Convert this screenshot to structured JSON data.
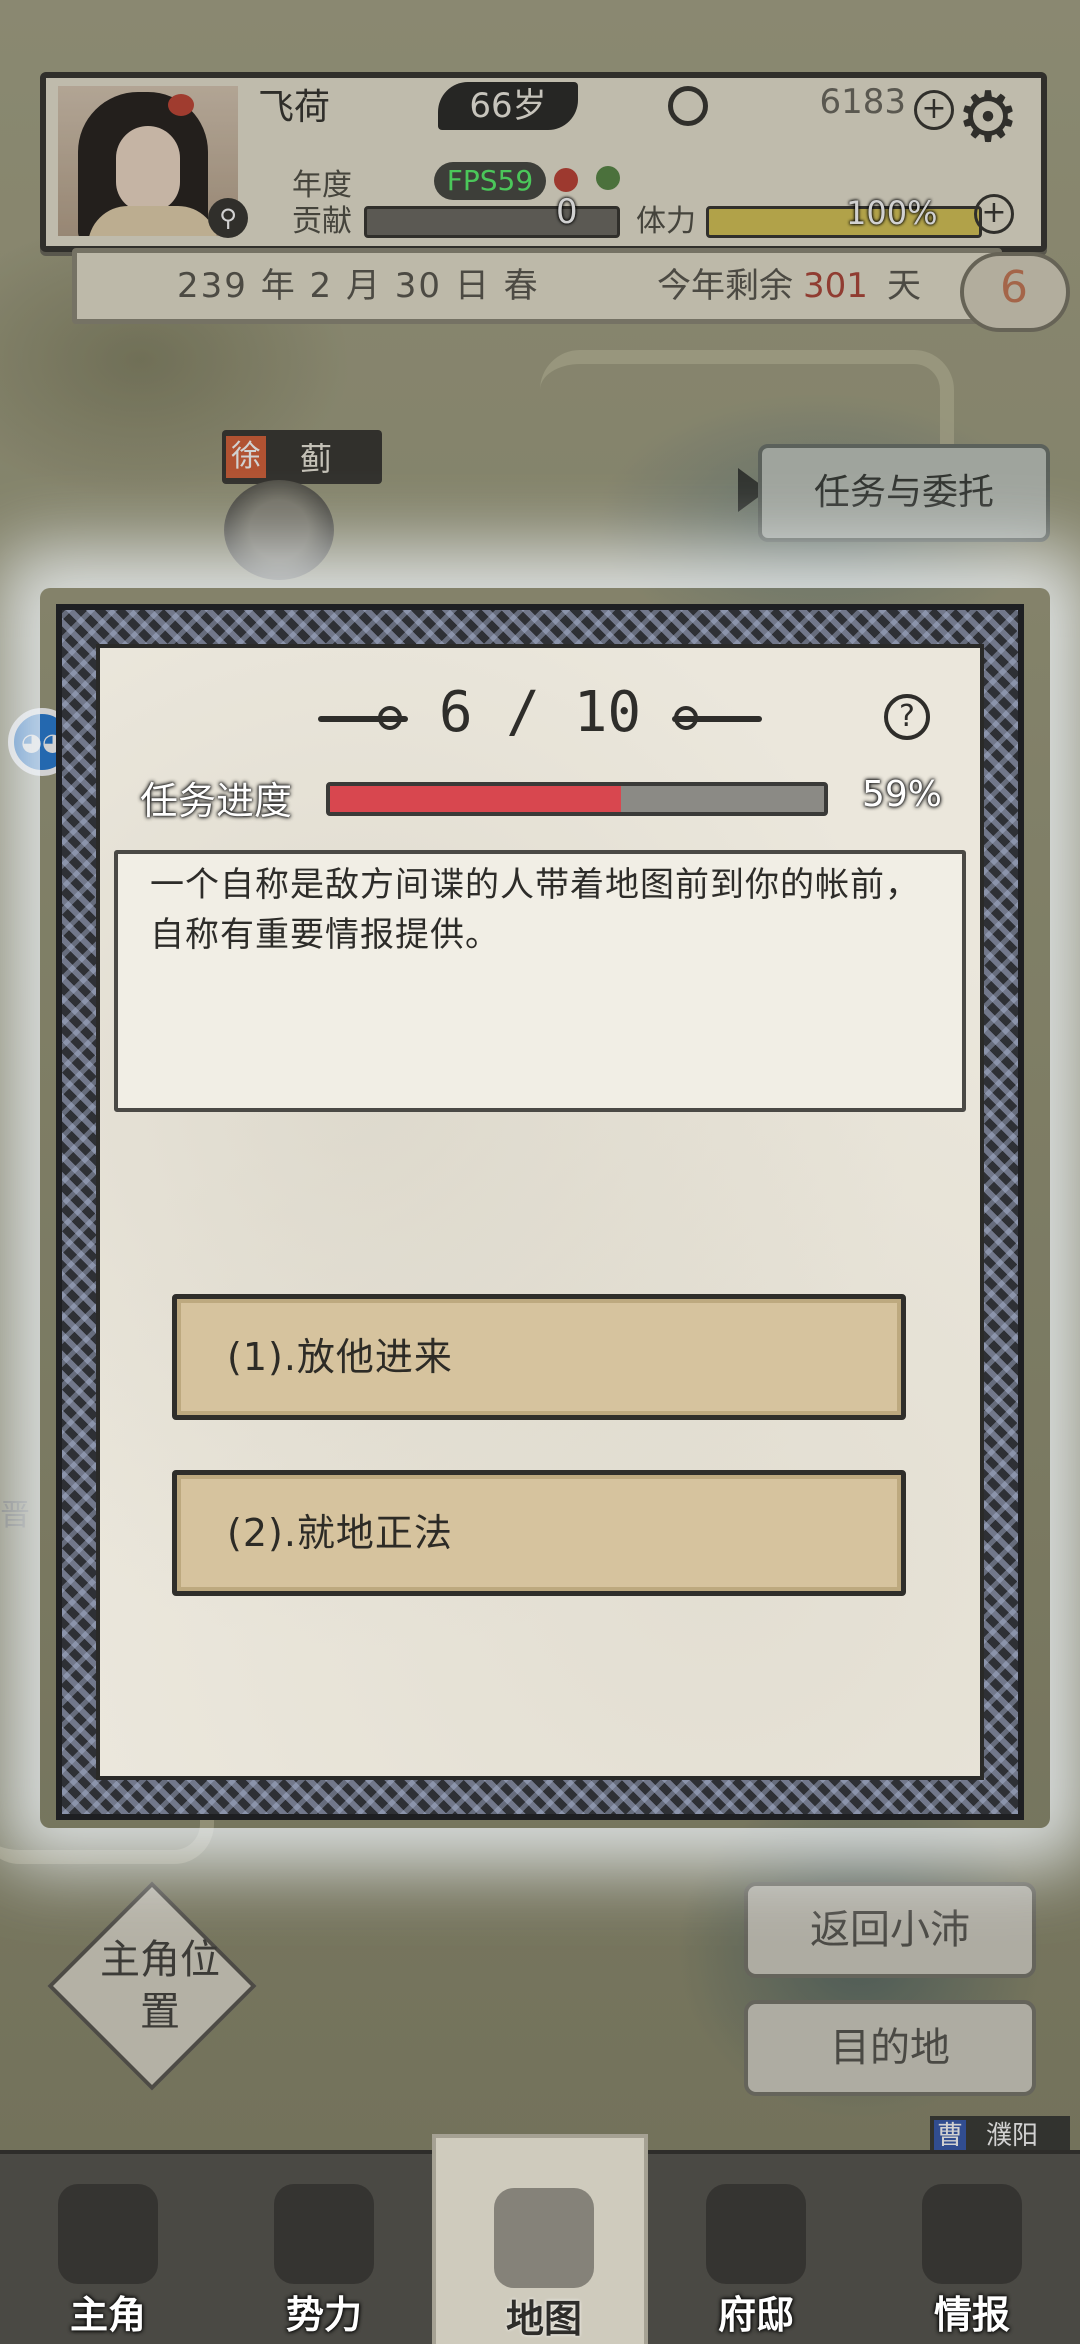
{
  "header": {
    "name": "飞荷",
    "age": "66岁",
    "coins": "6183",
    "fps": "FPS59",
    "year_label": "年度",
    "contrib_label": "贡献",
    "contrib_value": "0",
    "stamina_label": "体力",
    "stamina_value": "100%",
    "stamina_fraction": 1.0
  },
  "datebar": {
    "date": "239 年 2 月 30 日 春",
    "remain_label": "今年剩余",
    "remain_days": "301",
    "remain_unit": "天",
    "badge": "6"
  },
  "map": {
    "city_tag_faction": "徐",
    "city_tag_name": "蓟",
    "side_label": "晋",
    "quest_button": "任务与委托",
    "return_button": "返回小沛",
    "destination_button": "目的地",
    "player_position": "主角位置",
    "corner_tag_faction": "曹",
    "corner_tag_name": "濮阳"
  },
  "dialog": {
    "step": "6 / 10",
    "progress_label": "任务进度",
    "progress_percent": "59%",
    "progress_fraction": 0.59,
    "description": "一个自称是敌方间谍的人带着地图前到你的帐前，自称有重要情报提供。",
    "choices": [
      "(1).放他进来",
      "(2).就地正法"
    ]
  },
  "nav": [
    "主角",
    "势力",
    "地图",
    "府邸",
    "情报"
  ],
  "colors": {
    "progress_fill": "#d8474f",
    "remain_days": "#b04a3c",
    "fps_text": "#5cf36e",
    "choice_bg": "#d6c39e"
  }
}
